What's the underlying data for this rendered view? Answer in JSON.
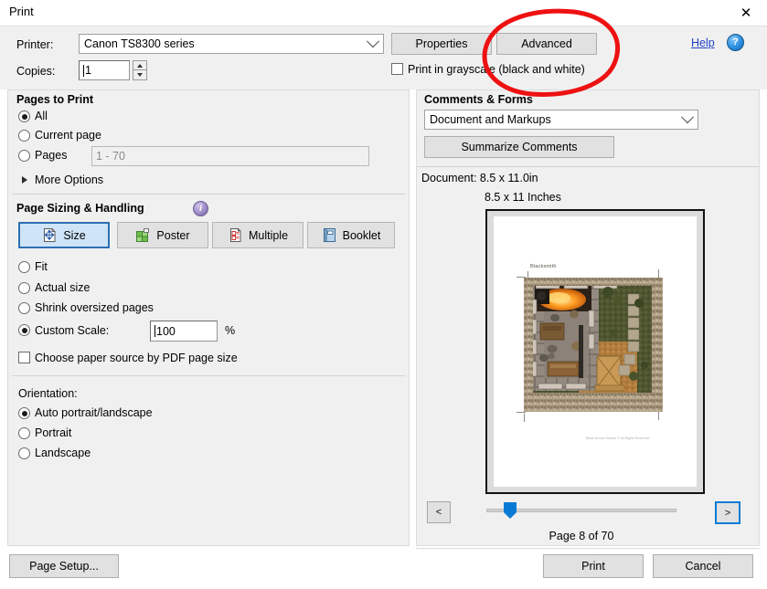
{
  "window": {
    "title": "Print",
    "close_icon": "close-icon"
  },
  "printer": {
    "printer_label": "Printer:",
    "printer_value": "Canon TS8300 series",
    "copies_label": "Copies:",
    "copies_value": "1",
    "properties_label": "Properties",
    "advanced_label": "Advanced",
    "grayscale_label": "Print in grayscale (black and white)",
    "grayscale_checked": false,
    "help_label": "Help",
    "help_icon": "question-circle-icon"
  },
  "pages_to_print": {
    "title": "Pages to Print",
    "options": [
      {
        "label": "All",
        "selected": true
      },
      {
        "label": "Current page",
        "selected": false
      },
      {
        "label": "Pages",
        "selected": false
      }
    ],
    "pages_placeholder": "1 - 70",
    "more_options_label": "More Options"
  },
  "page_sizing": {
    "title": "Page Sizing & Handling",
    "info_icon": "info-icon",
    "tabs": [
      {
        "label": "Size",
        "icon": "size-icon",
        "selected": true
      },
      {
        "label": "Poster",
        "icon": "poster-icon",
        "selected": false
      },
      {
        "label": "Multiple",
        "icon": "multiple-icon",
        "selected": false
      },
      {
        "label": "Booklet",
        "icon": "booklet-icon",
        "selected": false
      }
    ],
    "scale_options": [
      {
        "label": "Fit",
        "selected": false
      },
      {
        "label": "Actual size",
        "selected": false
      },
      {
        "label": "Shrink oversized pages",
        "selected": false
      },
      {
        "label": "Custom Scale:",
        "selected": true
      }
    ],
    "custom_scale_value": "100",
    "percent_symbol": "%",
    "paper_source_label": "Choose paper source by PDF page size",
    "paper_source_checked": false
  },
  "orientation": {
    "title": "Orientation:",
    "options": [
      {
        "label": "Auto portrait/landscape",
        "selected": true
      },
      {
        "label": "Portrait",
        "selected": false
      },
      {
        "label": "Landscape",
        "selected": false
      }
    ]
  },
  "comments_forms": {
    "title": "Comments & Forms",
    "selected_value": "Document and Markups",
    "summarize_label": "Summarize Comments"
  },
  "preview": {
    "document_size": "Document: 8.5 x 11.0in",
    "paper_size": "8.5 x 11 Inches",
    "page_title": "Blacksmith",
    "page_footer": "Black Scrolls Games © All Rights Reserved.",
    "prev_label": "<",
    "next_label": ">",
    "page_status": "Page 8 of 70",
    "slider_position_percent": 10
  },
  "footer": {
    "page_setup_label": "Page Setup...",
    "print_label": "Print",
    "cancel_label": "Cancel"
  },
  "annotation": {
    "shape": "red-ellipse",
    "color": "#ee1111",
    "target": "advanced-button"
  }
}
